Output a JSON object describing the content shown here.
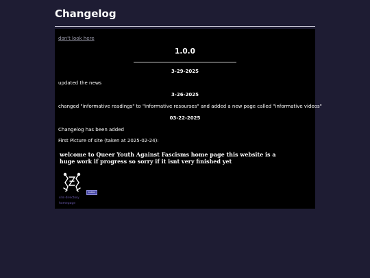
{
  "header": {
    "title": "Changelog"
  },
  "panel": {
    "top_link": "don't look here",
    "version": "1.0.0",
    "entries": [
      {
        "date": "3-29-2025",
        "note": "updated the news"
      },
      {
        "date": "3-26-2025",
        "note": "changed \"informative readings\" to \"informative resourses\" and added a new page called \"informative videos\""
      },
      {
        "date": "03-22-2025",
        "note": "Changelog has been added"
      }
    ],
    "first_picture_label": "First Picture of site (taken at 2025-02-24):",
    "screenshot": {
      "welcome_text": "welcome to Queer Youth Against Fascisms home page this website is a huge work if progress so sorry if it isnt very finished yet",
      "button_label": "button",
      "tiny_links": [
        "site directory",
        "homepage"
      ]
    }
  },
  "colors": {
    "background": "#1e1c33",
    "panel": "#000000",
    "text": "#ffffff",
    "link": "#9b9bab"
  }
}
